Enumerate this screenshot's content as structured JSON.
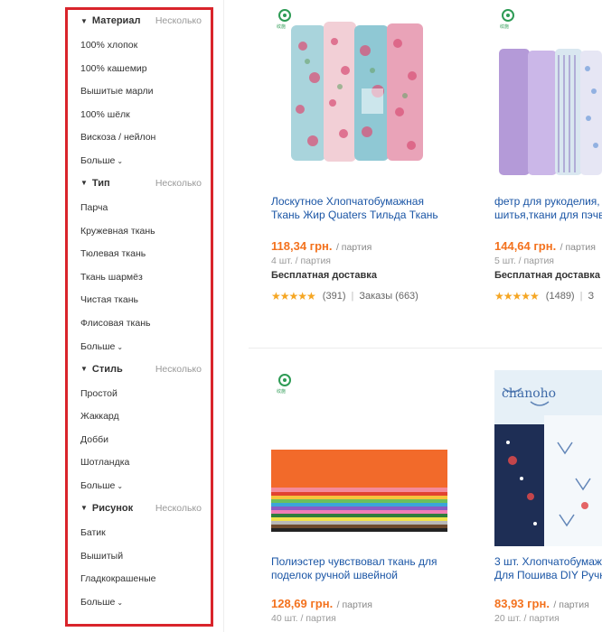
{
  "filters": {
    "groups": [
      {
        "title": "Материал",
        "multi": "Несколько",
        "options": [
          "100% хлопок",
          "100% кашемир",
          "Вышитые марли",
          "100% шёлк",
          "Вискоза / нейлон"
        ],
        "more": "Больше"
      },
      {
        "title": "Тип",
        "multi": "Несколько",
        "options": [
          "Парча",
          "Кружевная ткань",
          "Тюлевая ткань",
          "Ткань шармёз",
          "Чистая ткань",
          "Флисовая ткань"
        ],
        "more": "Больше"
      },
      {
        "title": "Стиль",
        "multi": "Несколько",
        "options": [
          "Простой",
          "Жаккард",
          "Добби",
          "Шотландка"
        ],
        "more": "Больше"
      },
      {
        "title": "Рисунок",
        "multi": "Несколько",
        "options": [
          "Батик",
          "Вышитый",
          "Гладкокрашеные"
        ],
        "more": "Больше"
      }
    ]
  },
  "products": [
    {
      "logo": "纹施",
      "title1": "Лоскутное Хлопчатобумажная",
      "title2": "Ткань Жир Quaters Тильда Ткань",
      "price": "118,34 грн.",
      "unit": "/ партия",
      "qty": "4 шт. / партия",
      "shipping": "Бесплатная доставка",
      "stars": "★★★★★",
      "reviews": "(391)",
      "orders": "Заказы (663)"
    },
    {
      "logo": "纹施",
      "title1": "фетр для рукоделия, т",
      "title2": "шитья,ткани для пэчв",
      "price": "144,64 грн.",
      "unit": "/ партия",
      "qty": "5 шт. / партия",
      "shipping": "Бесплатная доставка",
      "stars": "★★★★★",
      "reviews": "(1489)",
      "orders": "З"
    },
    {
      "logo": "纹施",
      "title1": "Полиэстер чувствовал ткань для",
      "title2": "поделок ручной швейной",
      "price": "128,69 грн.",
      "unit": "/ партия",
      "qty": "40 шт. / партия"
    },
    {
      "title1": "3 шт. Хлопчатобумажн",
      "title2": "Для Пошива DIY Ручн",
      "price": "83,93 грн.",
      "unit": "/ партия",
      "qty": "20 шт. / партия",
      "image_text": "chanoho"
    }
  ],
  "colors": {
    "sidebar_border": "#d9242b",
    "link": "#1a55a5",
    "price": "#f3721e",
    "stars": "#f5a623"
  }
}
